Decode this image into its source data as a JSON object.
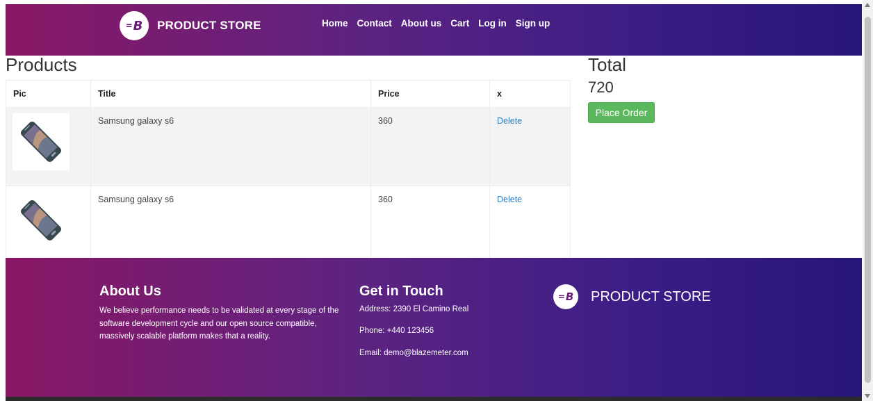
{
  "header": {
    "brand_text": "PRODUCT STORE",
    "logo_letter": "B",
    "nav": [
      {
        "label": "Home"
      },
      {
        "label": "Contact"
      },
      {
        "label": "About us"
      },
      {
        "label": "Cart"
      },
      {
        "label": "Log in"
      },
      {
        "label": "Sign up"
      }
    ]
  },
  "cart": {
    "heading": "Products",
    "columns": {
      "pic": "Pic",
      "title": "Title",
      "price": "Price",
      "x": "x"
    },
    "rows": [
      {
        "title": "Samsung galaxy s6",
        "price": "360",
        "action": "Delete",
        "image": "phone-image"
      },
      {
        "title": "Samsung galaxy s6",
        "price": "360",
        "action": "Delete",
        "image": "phone-image"
      }
    ]
  },
  "summary": {
    "total_label": "Total",
    "total_value": "720",
    "place_order_label": "Place Order"
  },
  "footer": {
    "about_title": "About Us",
    "about_text": "We believe performance needs to be validated at every stage of the software development cycle and our open source compatible, massively scalable platform makes that a reality.",
    "touch_title": "Get in Touch",
    "address": "Address: 2390 El Camino Real",
    "phone": "Phone: +440 123456",
    "email": "Email: demo@blazemeter.com",
    "brand_text": "PRODUCT STORE"
  },
  "colors": {
    "header_gradient_start": "#8a1765",
    "header_gradient_end": "#27157a",
    "place_order_bg": "#5cb85c",
    "link": "#2a7ec3"
  }
}
